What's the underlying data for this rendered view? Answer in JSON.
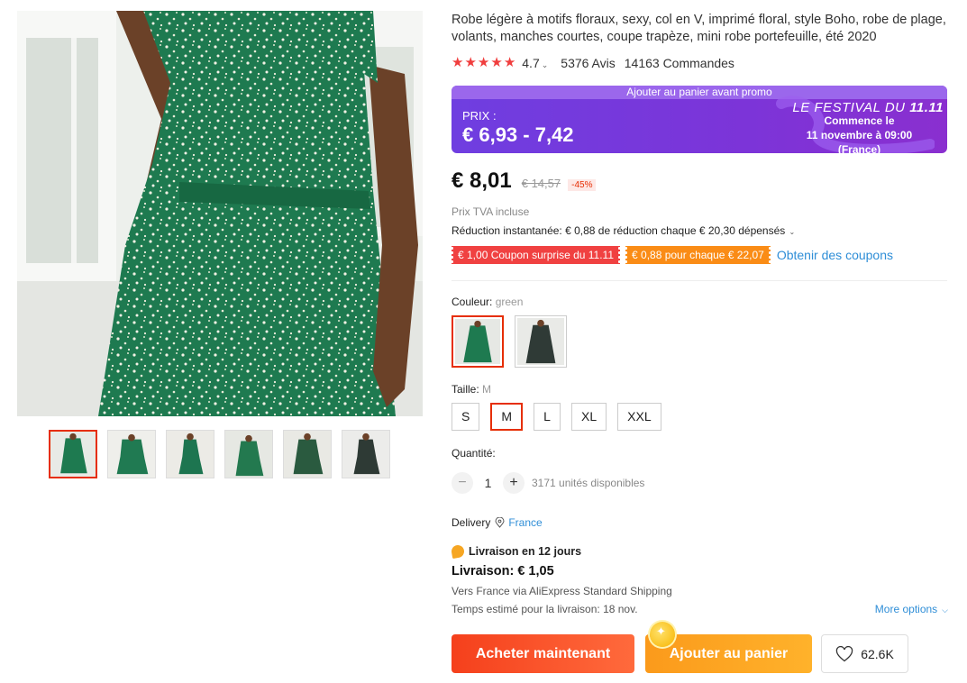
{
  "product": {
    "title": "Robe légère à motifs floraux, sexy, col en V, imprimé floral, style Boho, robe de plage, volants, manches courtes, coupe trapèze, mini robe portefeuille, été 2020",
    "rating": "4.7",
    "reviews": "5376 Avis",
    "orders": "14163 Commandes"
  },
  "promo": {
    "banner": "Ajouter au panier avant promo",
    "label": "PRIX :",
    "price_range": "€ 6,93 - 7,42",
    "festival_title": "LE FESTIVAL DU",
    "festival_num": "11.11",
    "festival_line1": "Commence le",
    "festival_line2": "11 novembre à 09:00",
    "festival_line3": "(France)"
  },
  "pricing": {
    "price": "€ 8,01",
    "old_price": "€ 14,57",
    "discount": "-45%",
    "vat": "Prix TVA incluse",
    "instant_discount": "Réduction instantanée: € 0,88 de réduction chaque € 20,30 dépensés"
  },
  "coupons": {
    "coupon1": "€ 1,00 Coupon surprise du 11.11",
    "coupon2": "€ 0,88 pour chaque € 22,07",
    "get_link": "Obtenir des coupons"
  },
  "color": {
    "label": "Couleur:",
    "selected": "green"
  },
  "size": {
    "label": "Taille:",
    "selected": "M",
    "options": [
      "S",
      "M",
      "L",
      "XL",
      "XXL"
    ]
  },
  "quantity": {
    "label": "Quantité:",
    "minus": "−",
    "value": "1",
    "plus": "+",
    "available": "3171 unités disponibles"
  },
  "delivery": {
    "label": "Delivery",
    "country": "France",
    "badge": "Livraison en 12 jours",
    "price": "Livraison: € 1,05",
    "via": "Vers France via AliExpress Standard Shipping",
    "estimate": "Temps estimé pour la livraison: 18 nov.",
    "more_options": "More options"
  },
  "actions": {
    "buy_now": "Acheter maintenant",
    "add_cart": "Ajouter au panier",
    "wishlist_count": "62.6K"
  },
  "colors": {
    "accent": "#e62e04",
    "promo_purple": "#7b3bdc",
    "link_blue": "#2f8ed7",
    "star_red": "#f03e3e",
    "dress_green": "#1f7a52"
  }
}
